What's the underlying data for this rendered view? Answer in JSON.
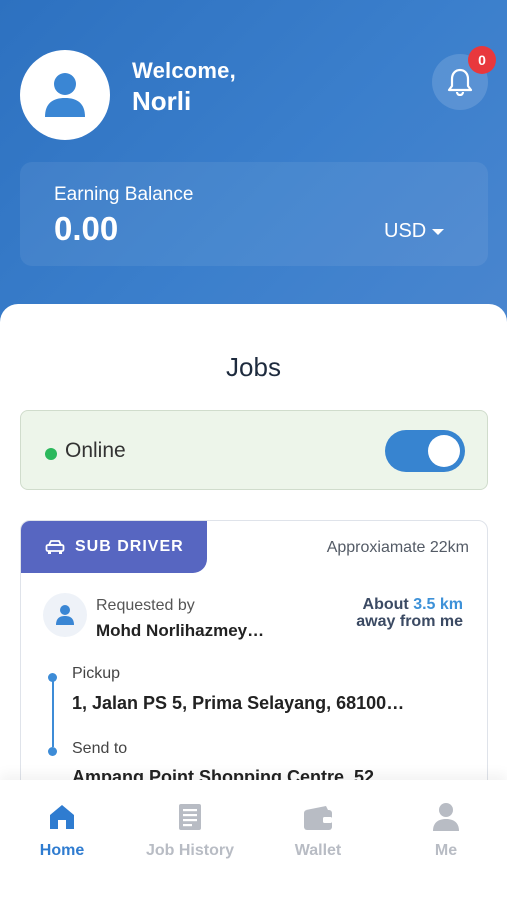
{
  "header": {
    "welcome": "Welcome,",
    "user_name": "Norli",
    "notification_count": "0",
    "earning_label": "Earning Balance",
    "earning_value": "0.00",
    "currency": "USD"
  },
  "jobs": {
    "title": "Jobs",
    "status_label": "Online",
    "online": true
  },
  "job_card": {
    "tag": "SUB DRIVER",
    "approx_distance": "Approxiamate 22km",
    "requested_by_label": "Requested by",
    "requester_name": "Mohd Norlihazmey…",
    "about_text": "About",
    "distance_value": "3.5 km",
    "away_text": "away from me",
    "pickup_label": "Pickup",
    "pickup_address": "1, Jalan PS 5, Prima Selayang, 68100…",
    "send_label": "Send to",
    "send_address": "Ampang Point Shopping Centre, 52..."
  },
  "bottom_nav": {
    "items": [
      {
        "label": "Home",
        "icon": "home-icon",
        "active": true
      },
      {
        "label": "Job History",
        "icon": "job-history-icon",
        "active": false
      },
      {
        "label": "Wallet",
        "icon": "wallet-icon",
        "active": false
      },
      {
        "label": "Me",
        "icon": "person-icon",
        "active": false
      }
    ]
  },
  "colors": {
    "header_blue": "#2d71c0",
    "accent_blue": "#3784d0",
    "online_green": "#2bb85c",
    "tag_purple": "#5766c1",
    "badge_red": "#e8383d",
    "nav_inactive": "#b8bcc4"
  }
}
